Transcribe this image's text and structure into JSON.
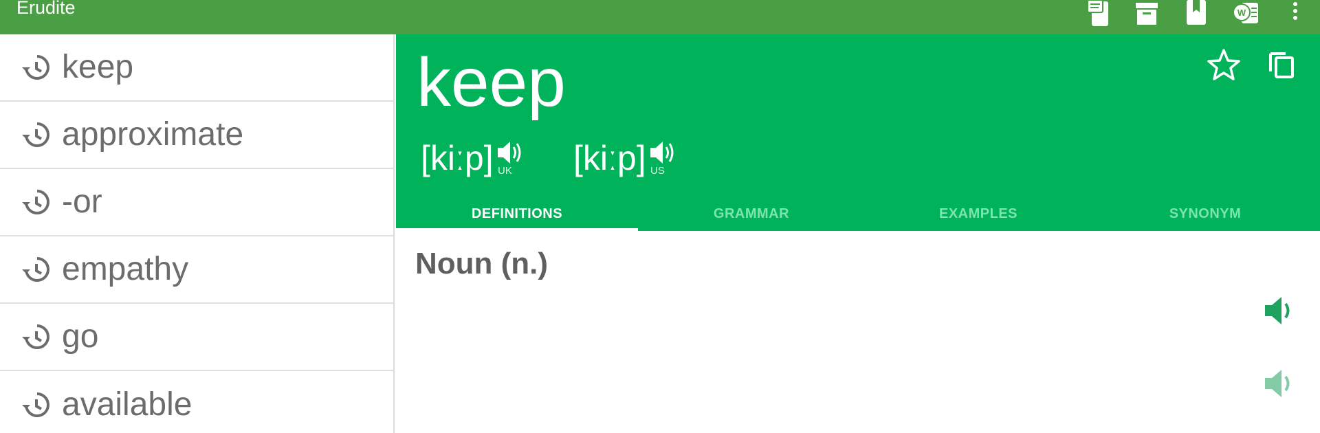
{
  "app": {
    "title": "Erudite"
  },
  "appbar_icons": [
    "notes-icon",
    "archive-icon",
    "bookmark-icon",
    "word-doc-icon",
    "more-vert-icon"
  ],
  "history": {
    "items": [
      {
        "label": "keep"
      },
      {
        "label": "approximate"
      },
      {
        "label": "-or"
      },
      {
        "label": "empathy"
      },
      {
        "label": "go"
      },
      {
        "label": "available"
      }
    ]
  },
  "word": {
    "title": "keep",
    "pronunciations": [
      {
        "text": "[kiːp]",
        "region": "UK"
      },
      {
        "text": "[kiːp]",
        "region": "US"
      }
    ]
  },
  "tabs": [
    {
      "label": "DEFINITIONS",
      "active": true
    },
    {
      "label": "GRAMMAR",
      "active": false
    },
    {
      "label": "EXAMPLES",
      "active": false
    },
    {
      "label": "SYNONYM",
      "active": false
    }
  ],
  "content": {
    "part_of_speech": "Noun (n.)"
  },
  "colors": {
    "appbar": "#4a9e43",
    "header": "#00b259",
    "accent_icon": "#1fa260"
  }
}
